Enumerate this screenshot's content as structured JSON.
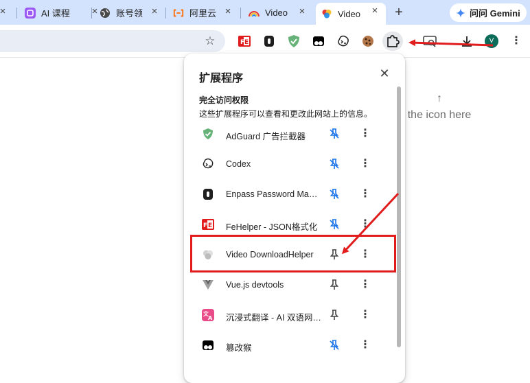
{
  "tabs": [
    {
      "label": "AI 课程",
      "icon": "ai-course-icon"
    },
    {
      "label": "账号领",
      "icon": "globe-icon"
    },
    {
      "label": "阿里云",
      "icon": "aliyun-icon"
    },
    {
      "label": "Video",
      "icon": "rainbow-icon"
    },
    {
      "label": "Video",
      "icon": "video-downloadhelper-icon",
      "active": true
    }
  ],
  "tab_close": "×",
  "new_tab": "+",
  "gemini": {
    "label": "问问 Gemini"
  },
  "toolbar": {
    "star": "☆",
    "profile_initial": "V",
    "menu": "⋮"
  },
  "page_hint": {
    "arrow": "↑",
    "text": "the icon here"
  },
  "panel": {
    "title": "扩展程序",
    "close": "✕",
    "section_title": "完全访问权限",
    "section_desc": "这些扩展程序可以查看和更改此网站上的信息。",
    "items": [
      {
        "name": "AdGuard 广告拦截器",
        "icon": "adguard-icon",
        "pinned": true
      },
      {
        "name": "Codex",
        "icon": "codex-icon",
        "pinned": true
      },
      {
        "name": "Enpass Password Manager",
        "icon": "enpass-icon",
        "pinned": true
      },
      {
        "name": "FeHelper - JSON格式化",
        "icon": "fehelper-icon",
        "pinned": true
      },
      {
        "name": "Video DownloadHelper",
        "icon": "video-downloadhelper-icon",
        "pinned": false
      },
      {
        "name": "Vue.js devtools",
        "icon": "vue-icon",
        "pinned": false
      },
      {
        "name": "沉浸式翻译 - AI 双语网页翻译",
        "icon": "immersive-translate-icon",
        "pinned": false
      },
      {
        "name": "篡改猴",
        "icon": "tampermonkey-icon",
        "pinned": true
      }
    ],
    "more": "⋮"
  },
  "colors": {
    "tabstrip_bg": "#d3e3fd",
    "pin_active": "#1a73e8",
    "annotation_red": "#e11c1c"
  }
}
